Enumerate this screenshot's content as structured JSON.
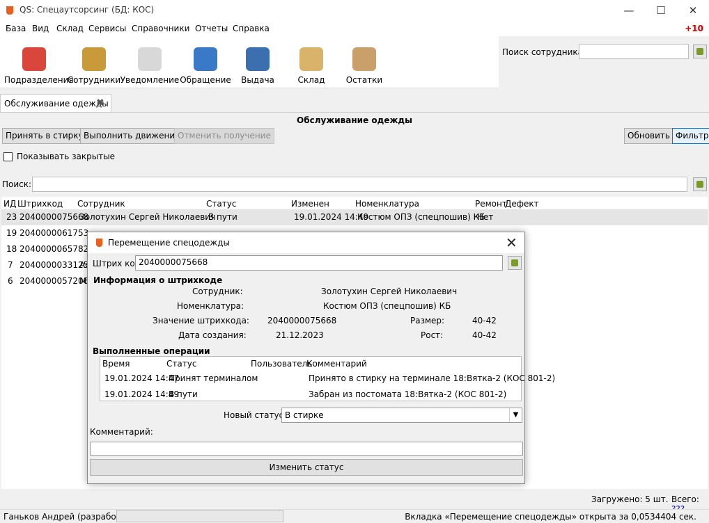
{
  "window": {
    "title": "QS: Спецаутсорсинг (БД: КОС)",
    "minimize": "—",
    "maximize": "☐",
    "close": "✕"
  },
  "menu": {
    "items": [
      "База",
      "Вид",
      "Склад",
      "Сервисы",
      "Справочники",
      "Отчеты",
      "Справка"
    ],
    "badge": "+10"
  },
  "toolbar": {
    "tools": [
      {
        "label": "Подразделения",
        "icon": "house-icon",
        "color": "#d9463b"
      },
      {
        "label": "Сотрудники",
        "icon": "people-icon",
        "color": "#c89a3a"
      },
      {
        "label": "Уведомление",
        "icon": "envelope-icon",
        "color": "#d8d8d8"
      },
      {
        "label": "Обращение",
        "icon": "mailbox-icon",
        "color": "#3a78c8"
      },
      {
        "label": "Выдача",
        "icon": "card-icon",
        "color": "#3b6fb0"
      },
      {
        "label": "Склад",
        "icon": "box-icon",
        "color": "#d9b36a"
      },
      {
        "label": "Остатки",
        "icon": "magnifier-box-icon",
        "color": "#c9a06a"
      }
    ],
    "employee_search_label": "Поиск сотрудника:"
  },
  "tab": {
    "label": "Обслуживание одежды"
  },
  "page": {
    "heading": "Обслуживание одежды",
    "buttons": {
      "wash": "Принять в стирку",
      "move": "Выполнить движение",
      "cancel": "Отменить получение",
      "refresh": "Обновить",
      "filter": "Фильтр"
    },
    "show_closed": "Показывать закрытые",
    "search_label": "Поиск:"
  },
  "grid": {
    "headers": [
      "ИД",
      "Штрихкод",
      "Сотрудник",
      "Статус",
      "Изменен",
      "Номенклатура",
      "Ремонт",
      "Дефект"
    ],
    "rows": [
      {
        "id": "23",
        "barcode": "2040000075668",
        "employee": "Золотухин Сергей Николаевич",
        "status": "В пути",
        "changed": "19.01.2024 14:49",
        "nomenclature": "Костюм ОПЗ (спецпошив) КБ",
        "repair": "Нет"
      },
      {
        "id": "19",
        "barcode": "2040000061753",
        "employee": "",
        "status": "",
        "changed": "",
        "nomenclature": "",
        "repair": ""
      },
      {
        "id": "18",
        "barcode": "2040000065782",
        "employee": "",
        "status": "",
        "changed": "",
        "nomenclature": "",
        "repair": ""
      },
      {
        "id": "7",
        "barcode": "2040000033125",
        "employee": "Ас",
        "status": "",
        "changed": "",
        "nomenclature": "",
        "repair": ""
      },
      {
        "id": "6",
        "barcode": "2040000057206",
        "employee": "М",
        "status": "",
        "changed": "",
        "nomenclature": "",
        "repair": ""
      }
    ]
  },
  "footer": {
    "loaded": "Загружено: 5 шт.",
    "total_label": "Всего:",
    "total_value": "???",
    "user": "Ганьков Андрей (разработка)",
    "tab_info": "Вкладка «Перемещение спецодежды» открыта за 0,0534404 сек."
  },
  "dialog": {
    "title": "Перемещение спецодежды",
    "barcode_label": "Штрих код:",
    "barcode_value": "2040000075668",
    "info_heading": "Информация о штрихкоде",
    "employee_label": "Сотрудник:",
    "employee_value": "Золотухин Сергей Николаевич",
    "nomenclature_label": "Номенклатура:",
    "nomenclature_value": "Костюм ОПЗ (спецпошив) КБ",
    "barcode_value_label": "Значение штрихкода:",
    "barcode_value_value": "2040000075668",
    "size_label": "Размер:",
    "size_value": "40-42",
    "created_label": "Дата создания:",
    "created_value": "21.12.2023",
    "height_label": "Рост:",
    "height_value": "40-42",
    "ops_heading": "Выполненные операции",
    "ops_headers": [
      "Время",
      "Статус",
      "Пользователь",
      "Комментарий"
    ],
    "ops_rows": [
      {
        "time": "19.01.2024 14:47",
        "status": "Принят терминалом",
        "user": "",
        "comment": "Принято в стирку на терминале 18:Вятка-2 (КОС 801-2)"
      },
      {
        "time": "19.01.2024 14:49",
        "status": "В пути",
        "user": "",
        "comment": "Забран из постомата 18:Вятка-2 (КОС 801-2)"
      }
    ],
    "new_status_label": "Новый статус:",
    "new_status_value": "В стирке",
    "comment_label": "Комментарий:",
    "change_button": "Изменить статус"
  }
}
